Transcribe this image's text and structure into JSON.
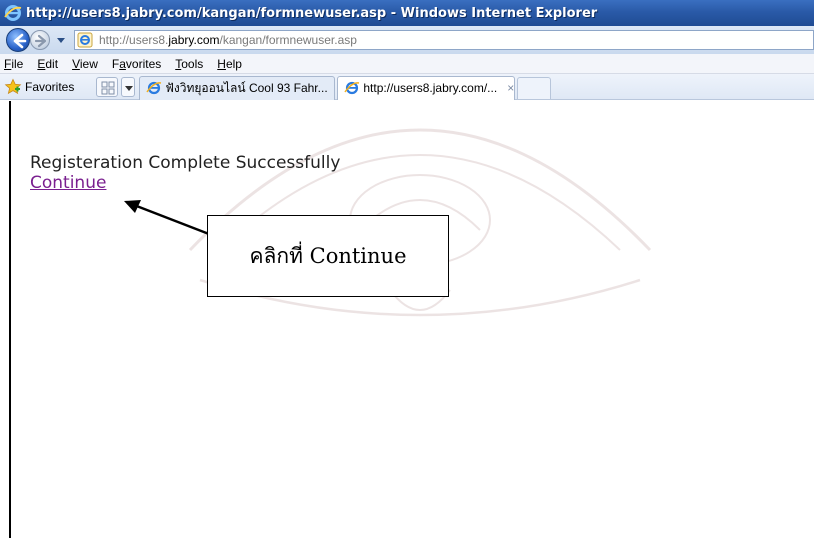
{
  "window": {
    "title": "http://users8.jabry.com/kangan/formnewuser.asp - Windows Internet Explorer"
  },
  "address_bar": {
    "url_prefix": "http://users8.",
    "url_domain": "jabry.com",
    "url_suffix": "/kangan/formnewuser.asp"
  },
  "menu": {
    "items": [
      {
        "label": "File",
        "accel": "F",
        "rest": "ile"
      },
      {
        "label": "Edit",
        "accel": "E",
        "rest": "dit"
      },
      {
        "label": "View",
        "accel": "V",
        "rest": "iew"
      },
      {
        "label": "Favorites",
        "pre": "F",
        "accel": "a",
        "rest": "vorites"
      },
      {
        "label": "Tools",
        "accel": "T",
        "rest": "ools"
      },
      {
        "label": "Help",
        "accel": "H",
        "rest": "elp"
      }
    ]
  },
  "favorites_bar": {
    "favorites_label": "Favorites",
    "tabs": [
      {
        "label": "ฟังวิทยุออนไลน์ Cool 93 Fahr..."
      },
      {
        "label": "http://users8.jabry.com/...",
        "close": "×"
      }
    ]
  },
  "page": {
    "message": "Registeration Complete Successfully",
    "link": "Continue"
  },
  "annotation": {
    "text": "คลิกที่ Continue"
  },
  "colors": {
    "titlebar": "#2a5aa8",
    "link_visited": "#7a1f8f",
    "watermark": "#b58a8a"
  }
}
